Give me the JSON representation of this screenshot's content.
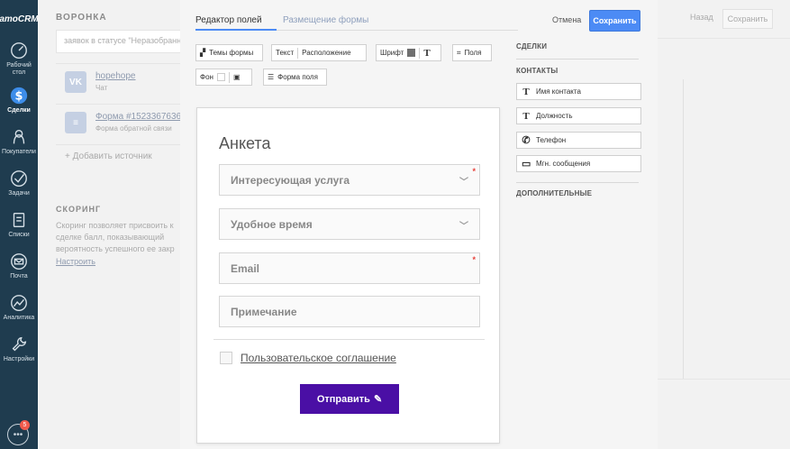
{
  "nav": {
    "logo": "amoCRM",
    "items": [
      {
        "label": "Рабочий стол",
        "icon": "dashboard-icon"
      },
      {
        "label": "Сделки",
        "icon": "deals-icon"
      },
      {
        "label": "Покупатели",
        "icon": "customers-icon"
      },
      {
        "label": "Задачи",
        "icon": "tasks-icon"
      },
      {
        "label": "Списки",
        "icon": "lists-icon"
      },
      {
        "label": "Почта",
        "icon": "mail-icon"
      },
      {
        "label": "Аналитика",
        "icon": "analytics-icon"
      },
      {
        "label": "Настройки",
        "icon": "settings-icon"
      }
    ],
    "chat_badge": "5"
  },
  "background": {
    "section_title": "ВОРОНКА",
    "status_text": "заявок в статусе \"Неразобранное\"",
    "sources": [
      {
        "name": "hopehope",
        "sub": "Чат",
        "icon": "vk-icon",
        "icon_text": "VK"
      },
      {
        "name": "Форма #1523367636",
        "sub": "Форма обратной связи",
        "icon": "form-icon",
        "icon_text": "≡"
      }
    ],
    "add_source": "+ Добавить источник",
    "scoring_title": "СКОРИНГ",
    "scoring_desc": [
      "Скоринг позволяет присвоить к",
      "сделке балл, показывающий",
      "вероятность успешного ее закр"
    ],
    "scoring_link": "Настроить",
    "back": "Назад",
    "save": "Сохранить"
  },
  "modal": {
    "tabs": {
      "editor": "Редактор полей",
      "placement": "Размещение формы"
    },
    "cancel": "Отмена",
    "save": "Сохранить",
    "toolbar": {
      "themes": "Темы формы",
      "text": "Текст",
      "position": "Расположение",
      "font": "Шрифт",
      "fields": "Поля",
      "bg": "Фон",
      "field_form": "Форма поля"
    },
    "form": {
      "title": "Анкета",
      "fields": [
        {
          "label": "Интересующая услуга",
          "type": "select",
          "required": true
        },
        {
          "label": "Удобное время",
          "type": "select",
          "required": false
        },
        {
          "label": "Email",
          "type": "text",
          "required": true
        },
        {
          "label": "Примечание",
          "type": "text",
          "required": false
        }
      ],
      "agreement": "Пользовательское соглашение",
      "submit": "Отправить"
    },
    "side": {
      "deals_header": "СДЕЛКИ",
      "contacts_header": "КОНТАКТЫ",
      "contact_fields": [
        {
          "label": "Имя контакта",
          "icon": "text-icon"
        },
        {
          "label": "Должность",
          "icon": "text-icon"
        },
        {
          "label": "Телефон",
          "icon": "phone-icon"
        },
        {
          "label": "Мгн. сообщения",
          "icon": "message-icon"
        }
      ],
      "extra_header": "ДОПОЛНИТЕЛЬНЫЕ"
    }
  },
  "colors": {
    "nav_bg": "#1f3c4f",
    "accent": "#4c8bf5",
    "submit_bg": "#4a0fa5",
    "required": "#e8403a"
  }
}
